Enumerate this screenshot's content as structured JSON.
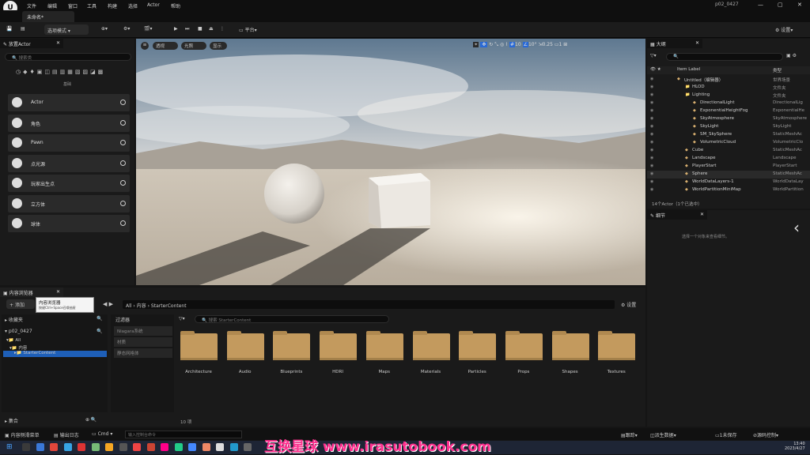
{
  "menu": [
    "文件",
    "编辑",
    "窗口",
    "工具",
    "构建",
    "选择",
    "Actor",
    "帮助"
  ],
  "project_name": "p02_0427",
  "tab_title": "未命名*",
  "toolbar": {
    "mode": "选项模式",
    "platform": "平台",
    "settings": "设置"
  },
  "place_actor": {
    "title": "放置Actor",
    "search_placeholder": "搜索类",
    "basic_label": "基础",
    "items": [
      "Actor",
      "角色",
      "Pawn",
      "点光源",
      "玩家出生点",
      "立方体",
      "球体"
    ]
  },
  "viewport": {
    "perspective": "透视",
    "lit": "光照",
    "show": "显示",
    "grid_size": "10",
    "angle": "10°",
    "scale": "0.25",
    "camera": "1"
  },
  "outliner": {
    "title": "大纲",
    "col_label": "Item Label",
    "col_type": "类型",
    "rows": [
      {
        "label": "Untitled（编辑器）",
        "type": "世界场景",
        "indent": 0
      },
      {
        "label": "HLOD",
        "type": "文件夹",
        "indent": 1
      },
      {
        "label": "Lighting",
        "type": "文件夹",
        "indent": 1
      },
      {
        "label": "DirectionalLight",
        "type": "DirectionalLig",
        "indent": 2
      },
      {
        "label": "ExponentialHeightFog",
        "type": "ExponentialHe",
        "indent": 2
      },
      {
        "label": "SkyAtmosphere",
        "type": "SkyAtmosphere",
        "indent": 2
      },
      {
        "label": "SkyLight",
        "type": "SkyLight",
        "indent": 2
      },
      {
        "label": "SM_SkySphere",
        "type": "StaticMeshAc",
        "indent": 2
      },
      {
        "label": "VolumetricCloud",
        "type": "VolumetricClo",
        "indent": 2
      },
      {
        "label": "Cube",
        "type": "StaticMeshAc",
        "indent": 1
      },
      {
        "label": "Landscape",
        "type": "Landscape",
        "indent": 1
      },
      {
        "label": "PlayerStart",
        "type": "PlayerStart",
        "indent": 1
      },
      {
        "label": "Sphere",
        "type": "StaticMeshAc",
        "indent": 1
      },
      {
        "label": "WorldDataLayers-1",
        "type": "WorldDataLay",
        "indent": 1
      },
      {
        "label": "WorldPartitionMiniMap",
        "type": "WorldPartition",
        "indent": 1
      }
    ],
    "count": "14个Actor（1个已选中）"
  },
  "details": {
    "title": "细节",
    "empty": "选择一个对象来查看细节。"
  },
  "content_browser": {
    "title": "内容浏览器",
    "add": "添加",
    "tooltip_title": "内容浏览器",
    "tooltip_sub": "按键Ctrl+Space召唤抽屉",
    "favorites": "收藏夹",
    "project": "p02_0427",
    "tree": [
      "All",
      "内容",
      "StarterContent"
    ],
    "filters": "过滤器",
    "filter_items": [
      "Niagara系统",
      "材质",
      "静态网格体"
    ],
    "path": [
      "All",
      "内容",
      "StarterContent"
    ],
    "settings": "设置",
    "search_placeholder": "搜索 StarterContent",
    "folders": [
      "Architecture",
      "Audio",
      "Blueprints",
      "HDRI",
      "Maps",
      "Materials",
      "Particles",
      "Props",
      "Shapes",
      "Textures"
    ],
    "item_count": "10 项",
    "collections": "集合"
  },
  "statusbar": {
    "drawer": "内容侧滑菜单",
    "output": "输出日志",
    "cmd": "Cmd",
    "cmd_placeholder": "输入控制台命令",
    "trace": "跟踪",
    "derived": "派生数据",
    "source_control": "源码控制",
    "revision": "1未保存"
  },
  "taskbar": {
    "time": "13:40",
    "date": "2023/4/27"
  },
  "watermark": "互换星球 www.irasutobook.com"
}
